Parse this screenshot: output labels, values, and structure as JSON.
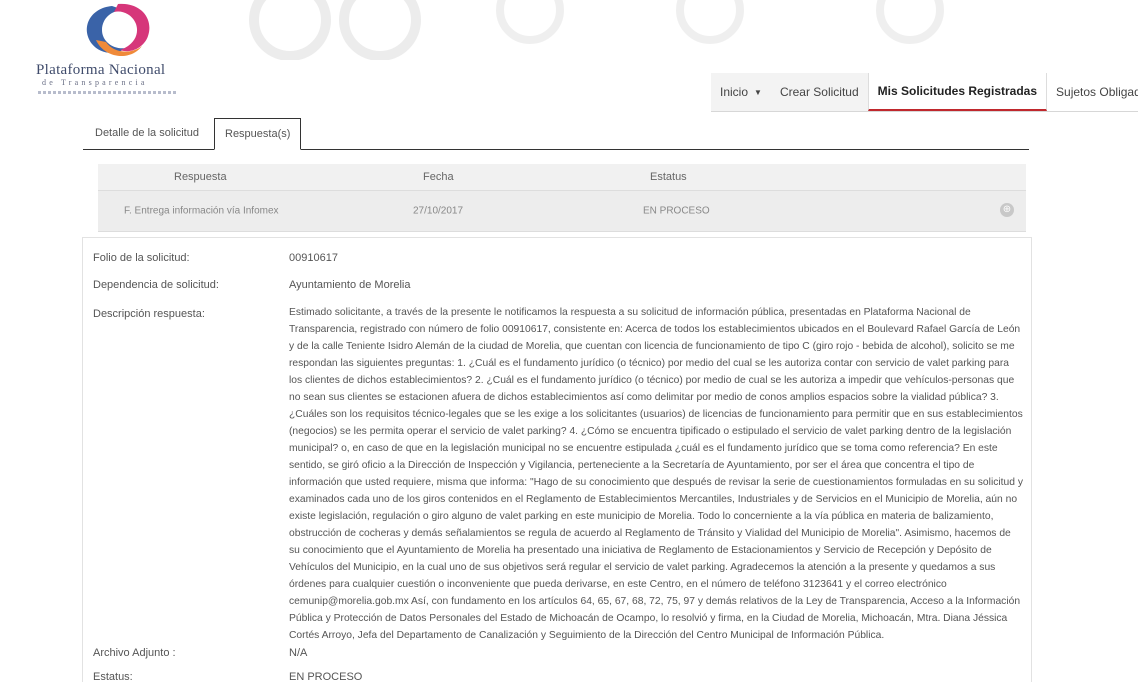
{
  "logo": {
    "title": "Plataforma Nacional",
    "subtitle": "de Transparencia",
    "colors": {
      "pink": "#d6367a",
      "blue": "#3a63a8",
      "orange": "#ef8a3a"
    }
  },
  "nav": {
    "items": [
      {
        "label": "Inicio",
        "has_dropdown": true
      },
      {
        "label": "Crear Solicitud"
      },
      {
        "label": "Mis Solicitudes Registradas",
        "active": true
      },
      {
        "label": "Sujetos Obligados"
      }
    ],
    "active_color": "#c0282d"
  },
  "tabs": [
    {
      "label": "Detalle de la solicitud"
    },
    {
      "label": "Respuesta(s)",
      "active": true
    }
  ],
  "table": {
    "headers": [
      "Respuesta",
      "Fecha",
      "Estatus"
    ],
    "rows": [
      {
        "respuesta": "F. Entrega información vía Infomex",
        "fecha": "27/10/2017",
        "estatus": "EN PROCESO",
        "icon": "expand-circle-icon"
      }
    ]
  },
  "detail": {
    "folio_label": "Folio de la solicitud:",
    "folio_value": "00910617",
    "dependencia_label": "Dependencia de solicitud:",
    "dependencia_value": "Ayuntamiento de Morelia",
    "descripcion_label": "Descripción respuesta:",
    "descripcion_value": "Estimado solicitante, a través de la presente le notificamos la respuesta a su solicitud de información pública, presentadas en Plataforma Nacional de Transparencia, registrado con número de folio 00910617, consistente en: Acerca de todos los establecimientos ubicados en el Boulevard Rafael García de León y de la calle Teniente Isidro Alemán de la ciudad de Morelia, que cuentan con licencia de funcionamiento de tipo C (giro rojo - bebida de alcohol), solicito se me respondan las siguientes preguntas: 1. ¿Cuál es el fundamento jurídico (o técnico) por medio del cual se les autoriza contar con servicio de valet parking para los clientes de dichos establecimientos? 2. ¿Cuál es el fundamento jurídico (o técnico) por medio de cual se les autoriza a impedir que vehículos-personas que no sean sus clientes se estacionen afuera de dichos establecimientos así como delimitar por medio de conos amplios espacios sobre la vialidad pública? 3. ¿Cuáles son los requisitos técnico-legales que se les exige a los solicitantes (usuarios) de licencias de funcionamiento para permitir que en sus establecimientos (negocios) se les permita operar el servicio de valet parking? 4. ¿Cómo se encuentra tipificado o estipulado el servicio de valet parking dentro de la legislación municipal? o, en caso de que en la legislación municipal no se encuentre estipulada ¿cuál es el fundamento jurídico que se toma como referencia? En este sentido, se giró oficio a la Dirección de Inspección y Vigilancia, perteneciente a la Secretaría de Ayuntamiento, por ser el área que concentra el tipo de información que usted requiere, misma que informa: \"Hago de su conocimiento que después de revisar la serie de cuestionamientos formuladas en su solicitud y examinados cada uno de los giros contenidos en el Reglamento de Establecimientos Mercantiles, Industriales y de Servicios en el Municipio de Morelia, aún no existe legislación, regulación o giro alguno de valet parking en este municipio de Morelia. Todo lo concerniente a la vía pública en materia de balizamiento, obstrucción de cocheras y demás señalamientos se regula de acuerdo al Reglamento de Tránsito y Vialidad del Municipio de Morelia\". Asimismo, hacemos de su conocimiento que el Ayuntamiento de Morelia ha presentado una iniciativa de Reglamento de Estacionamientos y Servicio de Recepción y Depósito de Vehículos del Municipio, en la cual uno de sus objetivos será regular el servicio de valet parking. Agradecemos la atención a la presente y quedamos a sus órdenes para cualquier cuestión o inconveniente que pueda derivarse, en este Centro, en el número de teléfono 3123641 y el correo electrónico cemunip@morelia.gob.mx Así, con fundamento en los artículos 64, 65, 67, 68, 72, 75, 97 y demás relativos de la Ley de Transparencia, Acceso a la Información Pública y Protección de Datos Personales del Estado de Michoacán de Ocampo, lo resolvió y firma, en la Ciudad de Morelia, Michoacán, Mtra. Diana Jéssica Cortés Arroyo, Jefa del Departamento de Canalización y Seguimiento de la Dirección del Centro Municipal de Información Pública.",
    "archivo_label": "Archivo Adjunto :",
    "archivo_value": "N/A",
    "estatus_label": "Estatus:",
    "estatus_value": "EN PROCESO"
  }
}
